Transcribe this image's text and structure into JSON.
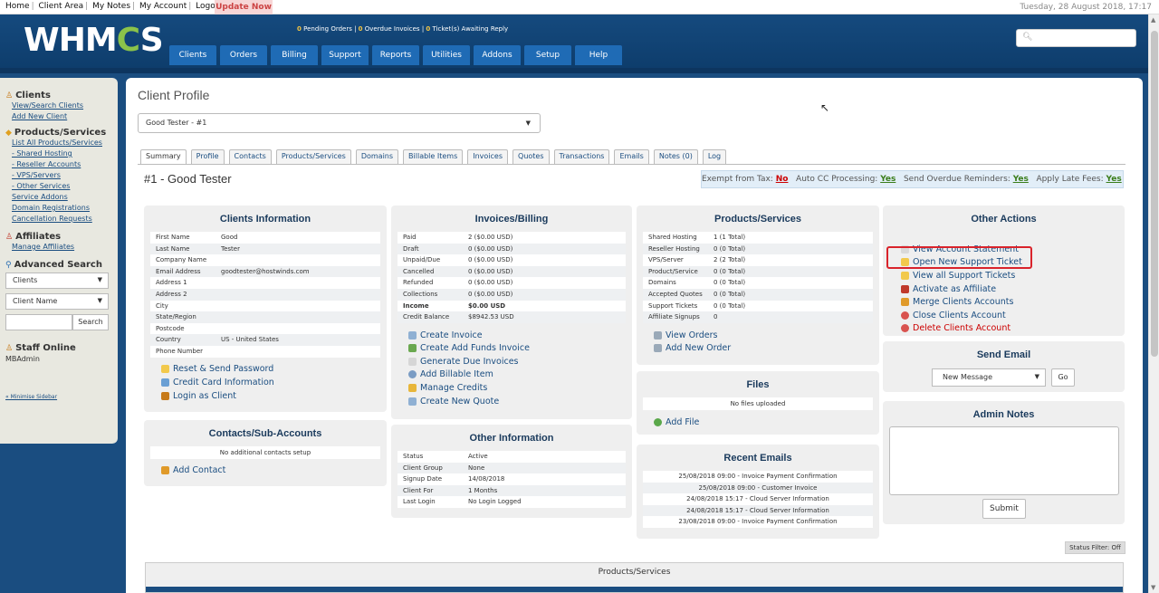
{
  "topbar": {
    "links": [
      "Home",
      "Client Area",
      "My Notes",
      "My Account",
      "Logout"
    ],
    "update": "Update Now",
    "datetime": "Tuesday, 28 August 2018, 17:17"
  },
  "header": {
    "logo_pre": "WHM",
    "logo_gear": "C",
    "logo_post": "S",
    "alerts": {
      "pending_count": "0",
      "pending_label": "Pending Orders",
      "overdue_count": "0",
      "overdue_label": "Overdue Invoices",
      "tickets_count": "0",
      "tickets_label": "Ticket(s) Awaiting Reply"
    },
    "nav": [
      "Clients",
      "Orders",
      "Billing",
      "Support",
      "Reports",
      "Utilities",
      "Addons",
      "Setup",
      "Help"
    ],
    "search_icon": "search-icon"
  },
  "sidebar": {
    "clients_title": "Clients",
    "clients_links": [
      "View/Search Clients",
      "Add New Client"
    ],
    "products_title": "Products/Services",
    "products_links": [
      "List All Products/Services",
      "- Shared Hosting",
      "- Reseller Accounts",
      "- VPS/Servers",
      "- Other Services",
      "Service Addons",
      "Domain Registrations",
      "Cancellation Requests"
    ],
    "affiliates_title": "Affiliates",
    "affiliates_links": [
      "Manage Affiliates"
    ],
    "advsearch_title": "Advanced Search",
    "advsearch_select1": "Clients",
    "advsearch_select2": "Client Name",
    "advsearch_button": "Search",
    "staff_title": "Staff Online",
    "staff_name": "MBAdmin",
    "minimise": "« Minimise Sidebar"
  },
  "main": {
    "title": "Client Profile",
    "client_select": "Good Tester - #1",
    "tabs": [
      "Summary",
      "Profile",
      "Contacts",
      "Products/Services",
      "Domains",
      "Billable Items",
      "Invoices",
      "Quotes",
      "Transactions",
      "Emails",
      "Notes (0)",
      "Log"
    ],
    "client_heading": "#1 - Good Tester",
    "flags": {
      "tax_label": "Exempt from Tax:",
      "tax_value": "No",
      "cc_label": "Auto CC Processing:",
      "cc_value": "Yes",
      "overdue_label": "Send Overdue Reminders:",
      "overdue_value": "Yes",
      "late_label": "Apply Late Fees:",
      "late_value": "Yes"
    },
    "client_info": {
      "title": "Clients Information",
      "rows": [
        {
          "k": "First Name",
          "v": "Good"
        },
        {
          "k": "Last Name",
          "v": "Tester"
        },
        {
          "k": "Company Name",
          "v": ""
        },
        {
          "k": "Email Address",
          "v": "goodtester@hostwinds.com"
        },
        {
          "k": "Address 1",
          "v": ""
        },
        {
          "k": "Address 2",
          "v": ""
        },
        {
          "k": "City",
          "v": ""
        },
        {
          "k": "State/Region",
          "v": ""
        },
        {
          "k": "Postcode",
          "v": ""
        },
        {
          "k": "Country",
          "v": "US - United States"
        },
        {
          "k": "Phone Number",
          "v": ""
        }
      ],
      "actions": [
        "Reset & Send Password",
        "Credit Card Information",
        "Login as Client"
      ]
    },
    "contacts": {
      "title": "Contacts/Sub-Accounts",
      "empty": "No additional contacts setup",
      "action": "Add Contact"
    },
    "invoices": {
      "title": "Invoices/Billing",
      "rows": [
        {
          "k": "Paid",
          "v": "2 ($0.00 USD)"
        },
        {
          "k": "Draft",
          "v": "0 ($0.00 USD)"
        },
        {
          "k": "Unpaid/Due",
          "v": "0 ($0.00 USD)"
        },
        {
          "k": "Cancelled",
          "v": "0 ($0.00 USD)"
        },
        {
          "k": "Refunded",
          "v": "0 ($0.00 USD)"
        },
        {
          "k": "Collections",
          "v": "0 ($0.00 USD)"
        },
        {
          "k": "Income",
          "v": "$0.00 USD"
        },
        {
          "k": "Credit Balance",
          "v": "$8942.53 USD"
        }
      ],
      "actions": [
        "Create Invoice",
        "Create Add Funds Invoice",
        "Generate Due Invoices",
        "Add Billable Item",
        "Manage Credits",
        "Create New Quote"
      ]
    },
    "other_info": {
      "title": "Other Information",
      "rows": [
        {
          "k": "Status",
          "v": "Active"
        },
        {
          "k": "Client Group",
          "v": "None"
        },
        {
          "k": "Signup Date",
          "v": "14/08/2018"
        },
        {
          "k": "Client For",
          "v": "1 Months"
        },
        {
          "k": "Last Login",
          "v": "No Login Logged"
        }
      ]
    },
    "products": {
      "title": "Products/Services",
      "rows": [
        {
          "k": "Shared Hosting",
          "v": "1 (1 Total)"
        },
        {
          "k": "Reseller Hosting",
          "v": "0 (0 Total)"
        },
        {
          "k": "VPS/Server",
          "v": "2 (2 Total)"
        },
        {
          "k": "Product/Service",
          "v": "0 (0 Total)"
        },
        {
          "k": "Domains",
          "v": "0 (0 Total)"
        },
        {
          "k": "Accepted Quotes",
          "v": "0 (0 Total)"
        },
        {
          "k": "Support Tickets",
          "v": "0 (0 Total)"
        },
        {
          "k": "Affiliate Signups",
          "v": "0"
        }
      ],
      "actions": [
        "View Orders",
        "Add New Order"
      ]
    },
    "files": {
      "title": "Files",
      "empty": "No files uploaded",
      "action": "Add File"
    },
    "emails": {
      "title": "Recent Emails",
      "rows": [
        "25/08/2018 09:00 - Invoice Payment Confirmation",
        "25/08/2018 09:00 - Customer Invoice",
        "24/08/2018 15:17 - Cloud Server Information",
        "24/08/2018 15:17 - Cloud Server Information",
        "23/08/2018 09:00 - Invoice Payment Confirmation"
      ]
    },
    "other_actions": {
      "title": "Other Actions",
      "actions": [
        "View Account Statement",
        "Open New Support Ticket",
        "View all Support Tickets",
        "Activate as Affiliate",
        "Merge Clients Accounts",
        "Close Clients Account",
        "Delete Clients Account"
      ]
    },
    "send_email": {
      "title": "Send Email",
      "select": "New Message",
      "button": "Go"
    },
    "admin_notes": {
      "title": "Admin Notes",
      "button": "Submit"
    },
    "status_filter": "Status Filter: Off",
    "ps_table_title": "Products/Services"
  }
}
